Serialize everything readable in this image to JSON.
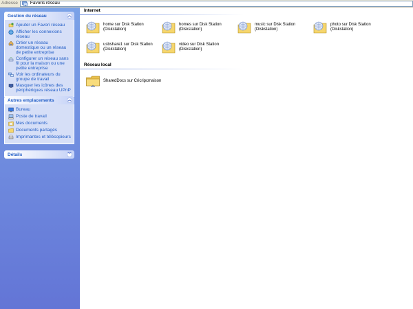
{
  "address_bar": {
    "label": "Adresse",
    "value": "Favoris réseau",
    "icon": "network-places-icon"
  },
  "task_pane": {
    "network_tasks": {
      "title": "Gestion du réseau",
      "items": [
        {
          "label": "Ajouter un Favori réseau",
          "icon": "add-network-place-icon"
        },
        {
          "label": "Afficher les connexions réseau",
          "icon": "network-connections-icon"
        },
        {
          "label": "Créer un réseau domestique ou un réseau de petite entreprise",
          "icon": "home-network-icon"
        },
        {
          "label": "Configurer un réseau sans fil pour la maison ou une petite entreprise",
          "icon": "wireless-network-icon"
        },
        {
          "label": "Voir les ordinateurs du groupe de travail",
          "icon": "workgroup-computers-icon"
        },
        {
          "label": "Masquer les icônes des périphériques réseau UPnP",
          "icon": "upnp-icon"
        }
      ]
    },
    "other_places": {
      "title": "Autres emplacements",
      "items": [
        {
          "label": "Bureau",
          "icon": "desktop-icon"
        },
        {
          "label": "Poste de travail",
          "icon": "my-computer-icon"
        },
        {
          "label": "Mes documents",
          "icon": "my-documents-icon"
        },
        {
          "label": "Documents partagés",
          "icon": "shared-documents-icon"
        },
        {
          "label": "Imprimantes et télécopieurs",
          "icon": "printers-icon"
        }
      ]
    },
    "details": {
      "title": "Détails"
    }
  },
  "content": {
    "groups": [
      {
        "title": "Internet",
        "items": [
          {
            "label": [
              "home sur Disk Station",
              "(Diskstation)"
            ],
            "icon": "web-folder-icon"
          },
          {
            "label": [
              "homes sur Disk Station",
              "(Diskstation)"
            ],
            "icon": "web-folder-icon"
          },
          {
            "label": [
              "music sur Disk Station",
              "(Diskstation)"
            ],
            "icon": "web-folder-icon"
          },
          {
            "label": [
              "photo sur Disk Station",
              "(Diskstation)"
            ],
            "icon": "web-folder-icon"
          },
          {
            "label": [
              "usbshare1 sur Disk Station",
              "(Diskstation)"
            ],
            "icon": "web-folder-icon"
          },
          {
            "label": [
              "video sur Disk Station",
              "(Diskstation)"
            ],
            "icon": "web-folder-icon"
          }
        ]
      },
      {
        "title": "Réseau local",
        "items": [
          {
            "label": [
              "SharedDocs sur Cricripcmaison"
            ],
            "icon": "network-folder-icon"
          }
        ]
      }
    ]
  },
  "colors": {
    "task_link": "#215dc6",
    "pane_gradient_top": "#7ba2e7",
    "pane_gradient_bottom": "#6375d6",
    "box_body": "#d6dff7",
    "folder": "#f6d66d"
  }
}
